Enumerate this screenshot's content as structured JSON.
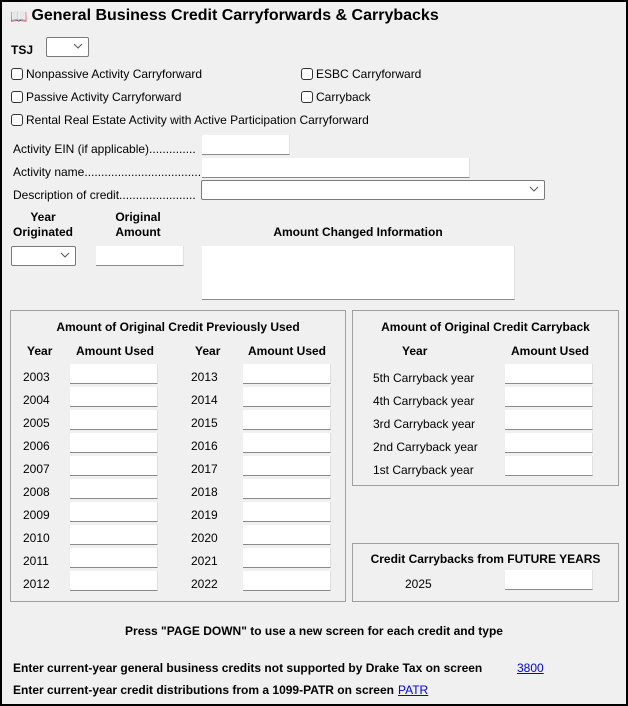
{
  "header": {
    "title": "General Business Credit Carryforwards & Carrybacks",
    "icon": "book-icon"
  },
  "tsj": {
    "label": "TSJ",
    "value": ""
  },
  "checkboxes": [
    {
      "label": "Nonpassive Activity Carryforward",
      "checked": false
    },
    {
      "label": "ESBC Carryforward",
      "checked": false
    },
    {
      "label": "Passive Activity Carryforward",
      "checked": false
    },
    {
      "label": "Carryback",
      "checked": false
    },
    {
      "label": "Rental Real Estate Activity with Active Participation Carryforward",
      "checked": false
    }
  ],
  "fields": {
    "ein_label": "Activity EIN (if applicable)..............",
    "ein_value": "",
    "name_label": "Activity name....................................",
    "name_value": "",
    "desc_label": "Description of credit.......................",
    "desc_value": ""
  },
  "origin": {
    "year_label_1": "Year",
    "year_label_2": "Originated",
    "amount_label_1": "Original",
    "amount_label_2": "Amount",
    "changed_label": "Amount Changed Information",
    "year_value": "",
    "amount_value": "",
    "changed_value": ""
  },
  "previously_used": {
    "title": "Amount of Original Credit Previously Used",
    "col_year": "Year",
    "col_amount": "Amount Used",
    "left_years": [
      "2003",
      "2004",
      "2005",
      "2006",
      "2007",
      "2008",
      "2009",
      "2010",
      "2011",
      "2012"
    ],
    "right_years": [
      "2013",
      "2014",
      "2015",
      "2016",
      "2017",
      "2018",
      "2019",
      "2020",
      "2021",
      "2022"
    ]
  },
  "carryback": {
    "title": "Amount of Original Credit Carryback",
    "col_year": "Year",
    "col_amount": "Amount Used",
    "rows": [
      "5th Carryback year",
      "4th Carryback year",
      "3rd Carryback year",
      "2nd Carryback year",
      "1st Carryback year"
    ]
  },
  "future": {
    "title": "Credit Carrybacks from FUTURE YEARS",
    "year": "2025",
    "value": ""
  },
  "footer": {
    "page_down_note": "Press \"PAGE DOWN\" to use a new screen for each credit and type",
    "line1_text": "Enter current-year general business credits not supported by Drake Tax on screen",
    "line1_link": "3800",
    "line2_text": "Enter current-year credit distributions from a 1099-PATR on screen",
    "line2_link": "PATR"
  }
}
